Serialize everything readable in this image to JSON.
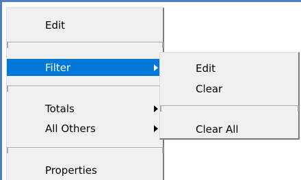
{
  "context_menu": {
    "items": [
      {
        "label": "Edit"
      },
      {
        "label": "Filter"
      },
      {
        "label": "Totals"
      },
      {
        "label": "All Others"
      },
      {
        "label": "Properties"
      }
    ]
  },
  "filter_submenu": {
    "items": [
      {
        "label": "Edit"
      },
      {
        "label": "Clear"
      },
      {
        "label": "Clear All"
      }
    ]
  },
  "colors": {
    "highlight": "#0078d7",
    "menu_background": "#f0f0f0",
    "window_frame": "#4f7ec9"
  }
}
